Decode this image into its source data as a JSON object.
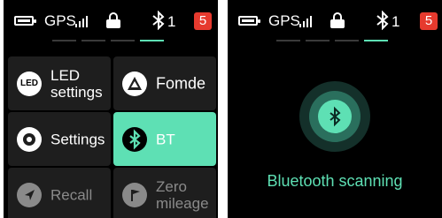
{
  "status": {
    "gps": "GPS",
    "bt_count": "1",
    "badge": "5"
  },
  "menu": {
    "tiles": [
      {
        "label": "LED settings",
        "icon": "led-icon"
      },
      {
        "label": "Fomde",
        "icon": "navigation-icon"
      },
      {
        "label": "Settings",
        "icon": "settings-icon"
      },
      {
        "label": "BT",
        "icon": "bluetooth-icon"
      },
      {
        "label": "Recall",
        "icon": "recall-icon"
      },
      {
        "label": "Zero mileage",
        "icon": "zero-mileage-icon"
      }
    ],
    "led_icon_text": "LED"
  },
  "scan": {
    "text": "Bluetooth scanning"
  },
  "colors": {
    "accent": "#5ee0b4",
    "badge": "#e63a2e",
    "tile": "#1e1e1e",
    "background": "#000000"
  }
}
